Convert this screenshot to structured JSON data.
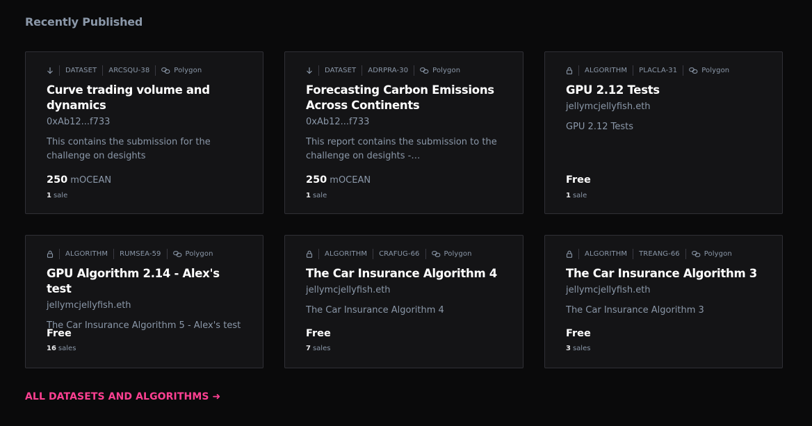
{
  "section": {
    "title": "Recently Published"
  },
  "cards": [
    {
      "access": "download-icon",
      "type": "DATASET",
      "symbol": "ARCSQU-38",
      "network": "Polygon",
      "title": "Curve trading volume and dynamics",
      "owner": "0xAb12...f733",
      "description": "This contains the submission for the challenge on desights",
      "price_amount": "250",
      "price_unit": "mOCEAN",
      "sales_count": "1",
      "sales_label": "sale"
    },
    {
      "access": "download-icon",
      "type": "DATASET",
      "symbol": "ADRPRA-30",
      "network": "Polygon",
      "title": "Forecasting Carbon Emissions Across Continents",
      "owner": "0xAb12...f733",
      "description": "This report contains the submission to the challenge on desights - https://desights.ai…",
      "price_amount": "250",
      "price_unit": "mOCEAN",
      "sales_count": "1",
      "sales_label": "sale"
    },
    {
      "access": "lock-icon",
      "type": "ALGORITHM",
      "symbol": "PLACLA-31",
      "network": "Polygon",
      "title": "GPU 2.12 Tests",
      "owner": "jellymcjellyfish.eth",
      "description": "GPU 2.12 Tests",
      "price_amount": "Free",
      "price_unit": "",
      "sales_count": "1",
      "sales_label": "sale"
    },
    {
      "access": "lock-icon",
      "type": "ALGORITHM",
      "symbol": "RUMSEA-59",
      "network": "Polygon",
      "title": "GPU Algorithm 2.14 - Alex's test",
      "owner": "jellymcjellyfish.eth",
      "description": "The Car Insurance Algorithm 5 - Alex's test",
      "price_amount": "Free",
      "price_unit": "",
      "sales_count": "16",
      "sales_label": "sales"
    },
    {
      "access": "lock-icon",
      "type": "ALGORITHM",
      "symbol": "CRAFUG-66",
      "network": "Polygon",
      "title": "The Car Insurance Algorithm 4",
      "owner": "jellymcjellyfish.eth",
      "description": "The Car Insurance Algorithm 4",
      "price_amount": "Free",
      "price_unit": "",
      "sales_count": "7",
      "sales_label": "sales"
    },
    {
      "access": "lock-icon",
      "type": "ALGORITHM",
      "symbol": "TREANG-66",
      "network": "Polygon",
      "title": "The Car Insurance Algorithm 3",
      "owner": "jellymcjellyfish.eth",
      "description": "The Car Insurance Algorithm 3",
      "price_amount": "Free",
      "price_unit": "",
      "sales_count": "3",
      "sales_label": "sales"
    }
  ],
  "footer": {
    "all_link": "ALL DATASETS AND ALGORITHMS ➜"
  },
  "colors": {
    "accent": "#ff4092",
    "background": "#0a0a0b",
    "card": "#141416",
    "muted": "#8b98a9"
  }
}
